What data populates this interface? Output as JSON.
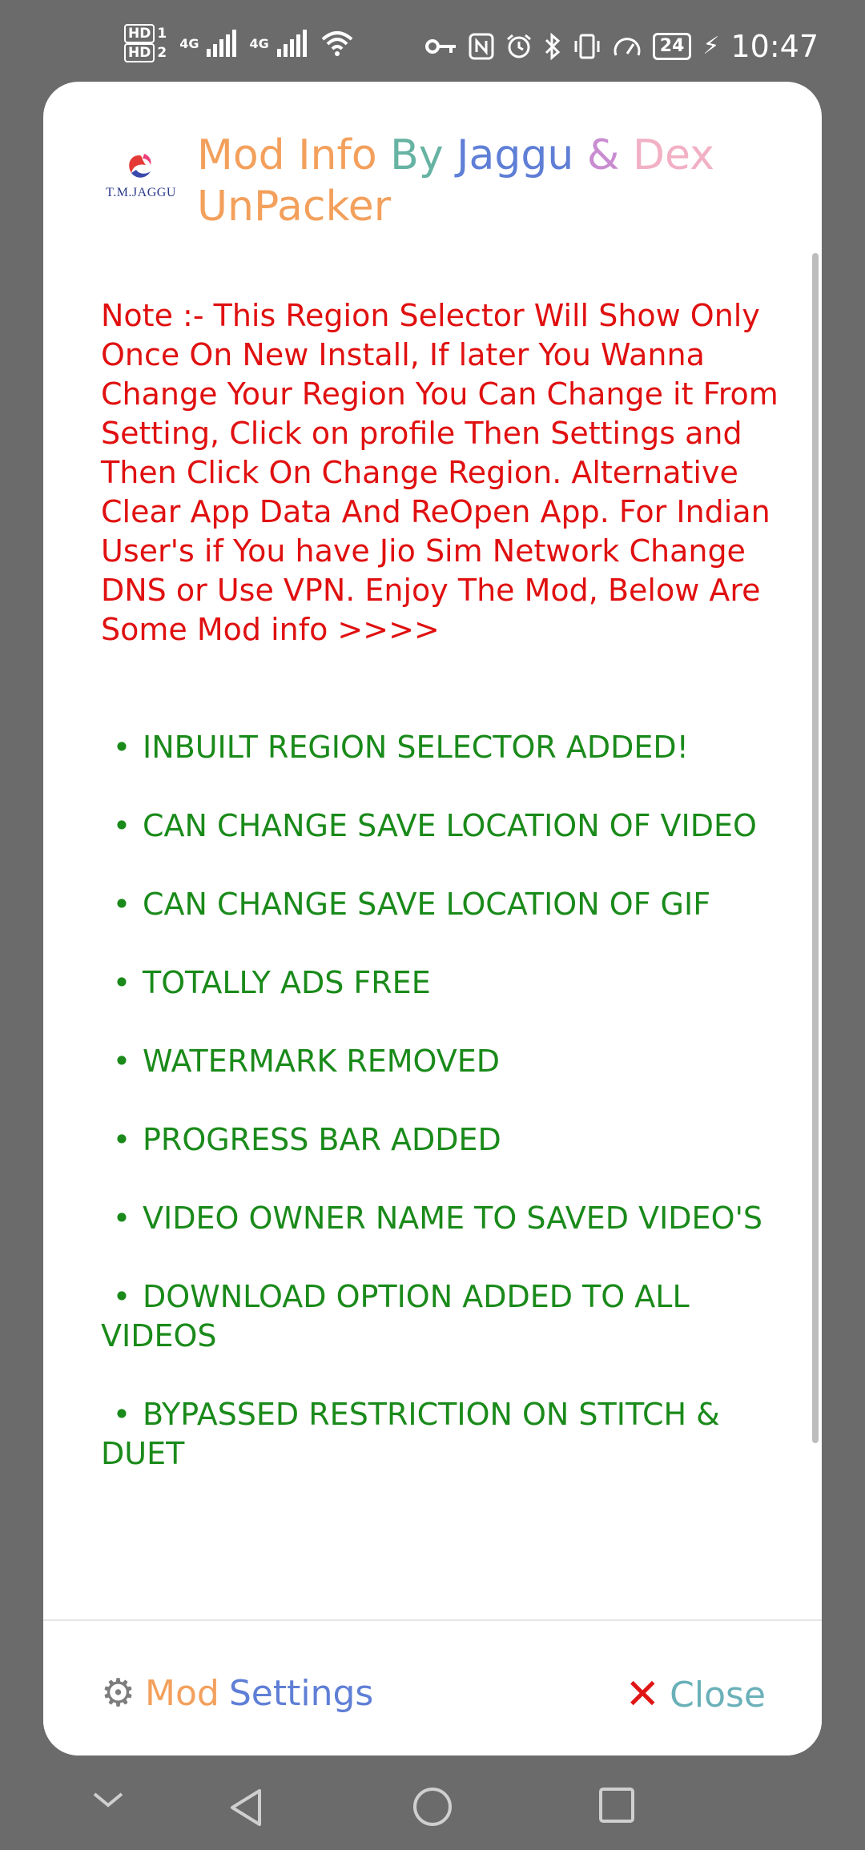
{
  "status_bar": {
    "hd1": "HD",
    "sim1": "1",
    "hd2": "HD",
    "sim2": "2",
    "net1": "4G",
    "net2": "4G",
    "battery": "24",
    "time": "10:47"
  },
  "dialog": {
    "logo_text": "T.M.JAGGU",
    "title": {
      "mod": "Mod",
      "info": "Info",
      "by": "By",
      "jaggu": "Jaggu",
      "amp": "&",
      "dex": "Dex",
      "unpacker": "UnPacker"
    },
    "note": "Note :- This Region Selector Will Show Only Once On New Install, If later You Wanna Change Your Region You Can Change it From Setting, Click on profile Then Settings and Then Click On Change Region. Alternative Clear App Data And ReOpen App. For Indian User's if You have Jio Sim Network Change DNS or Use VPN. Enjoy The Mod, Below Are Some Mod info >>>>",
    "bullet_char": "•",
    "features": [
      "INBUILT REGION SELECTOR ADDED!",
      "CAN CHANGE SAVE LOCATION OF VIDEO",
      "CAN CHANGE SAVE LOCATION OF GIF",
      "TOTALLY ADS FREE",
      "WATERMARK REMOVED",
      "PROGRESS BAR ADDED",
      "VIDEO OWNER NAME TO SAVED VIDEO'S",
      "DOWNLOAD OPTION ADDED TO ALL VIDEOS",
      "BYPASSED RESTRICTION ON STITCH & DUET"
    ],
    "buttons": {
      "settings_icon": "gear-icon",
      "settings_word1": "Mod",
      "settings_word2": "Settings",
      "close_icon": "cross-mark-icon",
      "close_label": "Close"
    }
  },
  "colors": {
    "note_red": "#e01010",
    "feature_green": "#1a8a1a",
    "overlay_gray": "#6b6b6b"
  }
}
